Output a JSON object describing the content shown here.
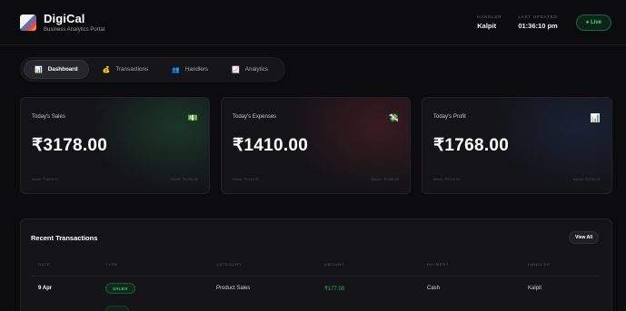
{
  "header": {
    "brand_title": "DigiCal",
    "brand_subtitle": "Business Analytics Portal",
    "handler_label": "HANDLER",
    "handler_value": "Kalpit",
    "updated_label": "LAST UPDATED",
    "updated_value": "01:36:10 pm",
    "live_label": "● Live"
  },
  "tabs": [
    {
      "label": "Dashboard",
      "icon": "📊"
    },
    {
      "label": "Transactions",
      "icon": "💰"
    },
    {
      "label": "Handlers",
      "icon": "👥"
    },
    {
      "label": "Analytics",
      "icon": "📈"
    }
  ],
  "cards": [
    {
      "label": "Today's Sales",
      "value": "₹3178.00",
      "icon": "💵",
      "week": "Week: ₹3868.00",
      "month": "Month: ₹4296.00"
    },
    {
      "label": "Today's Expenses",
      "value": "₹1410.00",
      "icon": "💸",
      "week": "Week: ₹1410.00",
      "month": "Month: ₹1498.00"
    },
    {
      "label": "Today's Profit",
      "value": "₹1768.00",
      "icon": "📊",
      "week": "Week: ₹2258.00",
      "month": "Month: ₹2798.00"
    }
  ],
  "colors": {
    "sales_glow": "#1f5a3a",
    "expense_glow": "#5a1f24",
    "profit_glow": "#1f2a4a",
    "accent_green": "#3ee07d"
  },
  "transactions": {
    "title": "Recent Transactions",
    "view_all": "View All",
    "columns": [
      "DATE",
      "TYPE",
      "CATEGORY",
      "AMOUNT",
      "PAYMENT",
      "HANDLER"
    ],
    "rows": [
      {
        "date": "9 Apr",
        "type": "SALES",
        "category": "Product Sales",
        "amount": "₹177.00",
        "payment": "Cash",
        "handler": "Kalpit"
      }
    ]
  }
}
